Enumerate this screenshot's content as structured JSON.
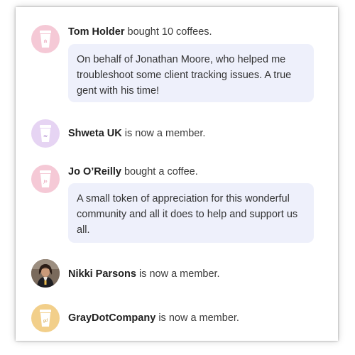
{
  "feed": [
    {
      "name": "Tom Holder",
      "action": "bought 10 coffees.",
      "avatar_initials": "th",
      "avatar_color": "#f5c9d6",
      "cup_color": "#e07a9b",
      "message": "On behalf of Jonathan Moore, who helped me troubleshoot some client tracking issues. A true gent with his time!"
    },
    {
      "name": "Shweta UK",
      "action": "is now a member.",
      "avatar_initials": "su",
      "avatar_color": "#e6d4f3",
      "cup_color": "#a57bc9"
    },
    {
      "name": "Jo O’Reilly",
      "action": "bought a coffee.",
      "avatar_initials": "jo",
      "avatar_color": "#f5c9d6",
      "cup_color": "#e07a9b",
      "message": "A small token of appreciation for this wonderful community and all it does to help and support us all."
    },
    {
      "name": "Nikki Parsons",
      "action": "is now a member.",
      "avatar_type": "photo"
    },
    {
      "name": "GrayDotCompany",
      "action": "is now a member.",
      "avatar_initials": "gd",
      "avatar_color": "#f2cf8a",
      "cup_color": "#c9962f"
    }
  ],
  "colors": {
    "bubble_bg": "#eef0fb",
    "text": "#3a3a3a"
  }
}
